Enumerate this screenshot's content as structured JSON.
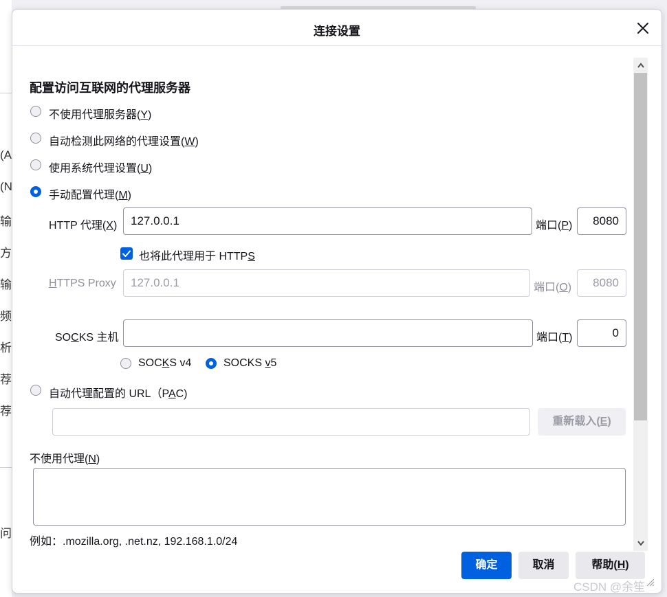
{
  "background": {
    "fragments": [
      "(A",
      "(N",
      "输",
      "方",
      "输",
      "频",
      "析",
      "荐",
      "荐",
      "问"
    ]
  },
  "dialog": {
    "title": "连接设置",
    "section_title": "配置访问互联网的代理服务器",
    "options": [
      {
        "label": "不使用代理服务器(",
        "mnemonic": "Y",
        "suffix": ")",
        "checked": false
      },
      {
        "label": "自动检测此网络的代理设置(",
        "mnemonic": "W",
        "suffix": ")",
        "checked": false
      },
      {
        "label": "使用系统代理设置(",
        "mnemonic": "U",
        "suffix": ")",
        "checked": false
      },
      {
        "label": "手动配置代理(",
        "mnemonic": "M",
        "suffix": ")",
        "checked": true
      }
    ],
    "http": {
      "label_pre": "HTTP 代理(",
      "mnemonic": "X",
      "label_post": ")",
      "value": "127.0.0.1",
      "port_label_pre": "端口(",
      "port_mnemonic": "P",
      "port_label_post": ")",
      "port_value": "8080"
    },
    "also_https": {
      "label_pre": "也将此代理用于 HTTP",
      "mnemonic": "S",
      "checked": true
    },
    "https": {
      "mnemonic": "H",
      "label_post": "TTPS Proxy",
      "value": "127.0.0.1",
      "port_label_pre": "端口(",
      "port_mnemonic": "O",
      "port_label_post": ")",
      "port_value": "8080"
    },
    "socks": {
      "label_pre": "SO",
      "mnemonic": "C",
      "label_post": "KS 主机",
      "value": "",
      "port_label_pre": "端口(",
      "port_mnemonic": "T",
      "port_label_post": ")",
      "port_value": "0",
      "v4": {
        "pre": "SOC",
        "mnemonic": "K",
        "post": "S v4",
        "checked": false
      },
      "v5": {
        "pre": "SOCKS ",
        "mnemonic": "v",
        "post": "5",
        "checked": true
      }
    },
    "pac": {
      "label_pre": "自动代理配置的 URL（P",
      "mnemonic": "A",
      "label_post": "C)",
      "checked": false,
      "value": ""
    },
    "reload_button": {
      "pre": "重新载入(",
      "mnemonic": "E",
      "post": ")"
    },
    "no_proxy": {
      "label_pre": "不使用代理(",
      "mnemonic": "N",
      "label_post": ")",
      "value": ""
    },
    "example": "例如：.mozilla.org, .net.nz, 192.168.1.0/24",
    "buttons": {
      "ok": "确定",
      "cancel": "取消",
      "help_pre": "帮助(",
      "help_mnemonic": "H",
      "help_post": ")"
    }
  },
  "watermark": "CSDN @余笙",
  "colors": {
    "accent": "#0061e0",
    "disabled_text": "#9c9ca6",
    "border": "#8f8f9d"
  }
}
